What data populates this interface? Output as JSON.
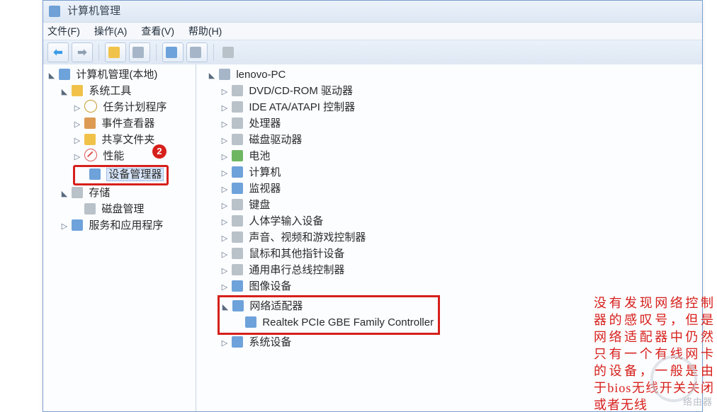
{
  "window": {
    "title": "计算机管理"
  },
  "menu": {
    "file": "文件(F)",
    "action": "操作(A)",
    "view": "查看(V)",
    "help": "帮助(H)"
  },
  "badge": {
    "number": "2"
  },
  "left_tree": {
    "root": "计算机管理(本地)",
    "sys_tools": "系统工具",
    "task_scheduler": "任务计划程序",
    "event_viewer": "事件查看器",
    "shared_folders": "共享文件夹",
    "performance": "性能",
    "device_manager": "设备管理器",
    "storage": "存储",
    "disk_mgmt": "磁盘管理",
    "services": "服务和应用程序"
  },
  "right_tree": {
    "root": "lenovo-PC",
    "dvd": "DVD/CD-ROM 驱动器",
    "ide": "IDE ATA/ATAPI 控制器",
    "cpu": "处理器",
    "disk_drive": "磁盘驱动器",
    "battery": "电池",
    "computer": "计算机",
    "monitor": "监视器",
    "keyboard": "键盘",
    "hid": "人体学输入设备",
    "sound": "声音、视频和游戏控制器",
    "mouse": "鼠标和其他指针设备",
    "usb": "通用串行总线控制器",
    "imaging": "图像设备",
    "network": "网络适配器",
    "nic0": "Realtek PCIe GBE Family Controller",
    "sysdev": "系统设备"
  },
  "annotation": {
    "text": "没有发现网络控制器的感叹号，但是网络适配器中仍然只有一个有线网卡的设备，一般是由于bios无线开关关闭或者无线"
  },
  "watermark": {
    "text": "络由器"
  }
}
